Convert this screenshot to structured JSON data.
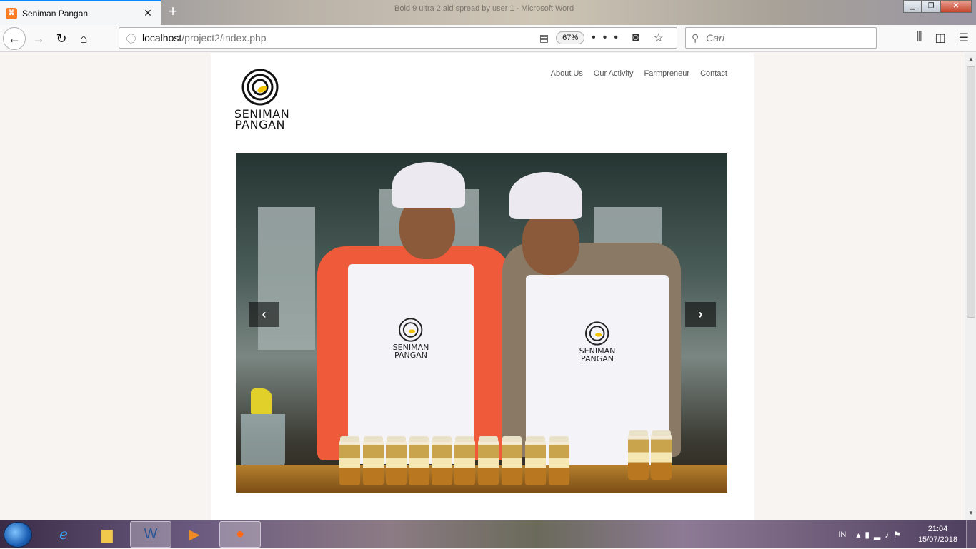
{
  "browser": {
    "tab_title": "Seniman Pangan",
    "tab_close": "✕",
    "new_tab": "+",
    "window_title": "Bold 9 ultra 2 aid spread by user 1 - Microsoft Word",
    "url_host": "localhost",
    "url_path": "/project2/index.php",
    "zoom": "67%",
    "search_placeholder": "Cari"
  },
  "site": {
    "logo_line1": "SENIMAN",
    "logo_line2": "PANGAN",
    "nav": [
      "About Us",
      "Our Activity",
      "Farmpreneur",
      "Contact"
    ],
    "apron_line1": "SENIMAN",
    "apron_line2": "PANGAN",
    "carousel_prev": "‹",
    "carousel_next": "›"
  },
  "taskbar": {
    "language": "IN",
    "time": "21:04",
    "date": "15/07/2018"
  },
  "colors": {
    "tab_accent": "#0a84ff",
    "logo_yellow": "#f2c200"
  }
}
